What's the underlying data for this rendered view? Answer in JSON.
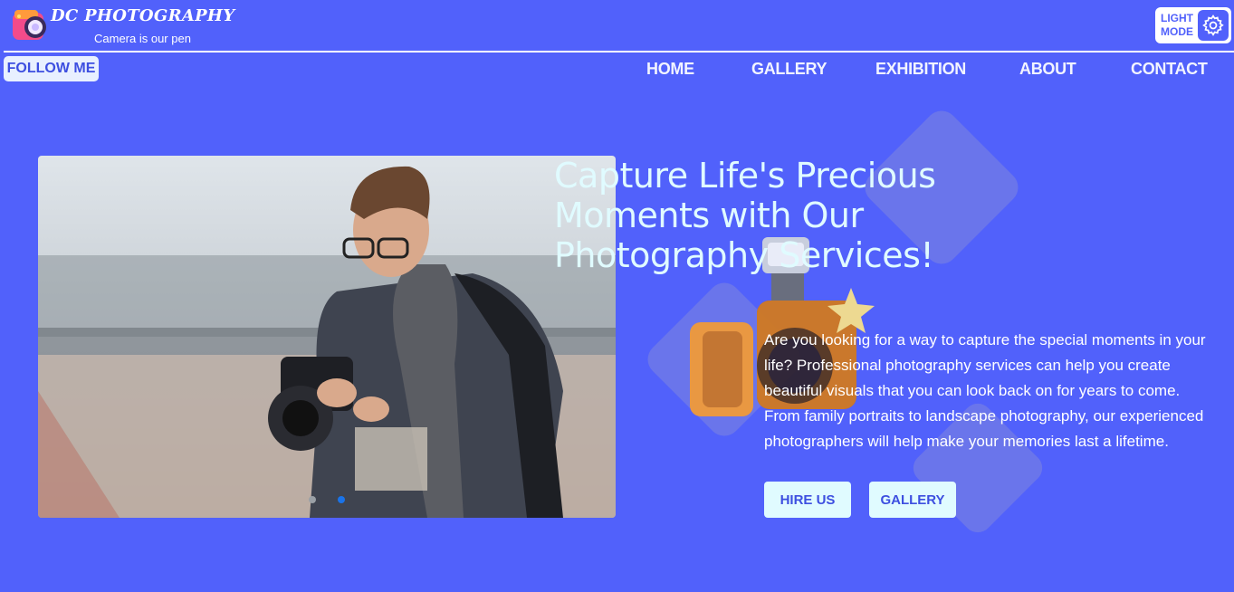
{
  "brand": {
    "title": "DC PHOTOGRAPHY",
    "tagline": "Camera is our pen",
    "logo_icon": "camera-logo-icon"
  },
  "mode_toggle": {
    "label_line1": "LIGHT",
    "label_line2": "MODE",
    "icon": "gear-icon"
  },
  "follow_button": "FOLLOW ME",
  "nav": {
    "items": [
      {
        "label": "HOME"
      },
      {
        "label": "GALLERY"
      },
      {
        "label": "EXHIBITION"
      },
      {
        "label": "ABOUT"
      },
      {
        "label": "CONTACT"
      }
    ]
  },
  "hero": {
    "headline": "Capture Life's Precious Moments with Our Photography Services!",
    "body": "Are you looking for a way to capture the special moments in your life? Professional photography services can help you create beautiful visuals that you can look back on for years to come. From family portraits to landscape photography, our experienced photographers will help make your memories last a lifetime.",
    "buttons": {
      "hire": "HIRE US",
      "gallery": "GALLERY"
    },
    "carousel": {
      "slide_count": 2,
      "active_index": 1
    }
  },
  "colors": {
    "background": "#5161fb",
    "headline": "#e0fbff",
    "button_bg": "#e0fbff",
    "button_text": "#3d4fe0",
    "carousel_active": "#1a73e8"
  }
}
